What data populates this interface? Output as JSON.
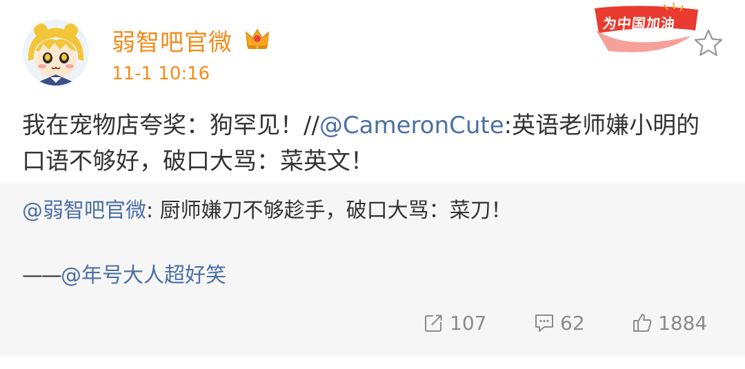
{
  "post": {
    "username": "弱智吧官微",
    "time": "11-1 10:16",
    "badge_text": "为中国加油",
    "text_part1": "我在宠物店夸奖：狗罕见！//",
    "mention1": "@CameronCute",
    "text_part2": ":英语老师嫌小明的口语不够好，破口大骂：菜英文！"
  },
  "repost": {
    "mention": "@弱智吧官微",
    "text": ": 厨师嫌刀不够趁手，破口大骂：菜刀！",
    "dash": "——",
    "credit": "@年号大人超好笑",
    "reposts": "107",
    "comments": "62",
    "likes": "1884"
  },
  "colors": {
    "name_accent": "#f48a18",
    "mention": "#4b6fa5",
    "repost_bg": "#f6f6f6"
  },
  "icons": [
    "avatar-image",
    "crown-icon",
    "star-icon",
    "repost-icon",
    "comment-icon",
    "like-icon"
  ]
}
